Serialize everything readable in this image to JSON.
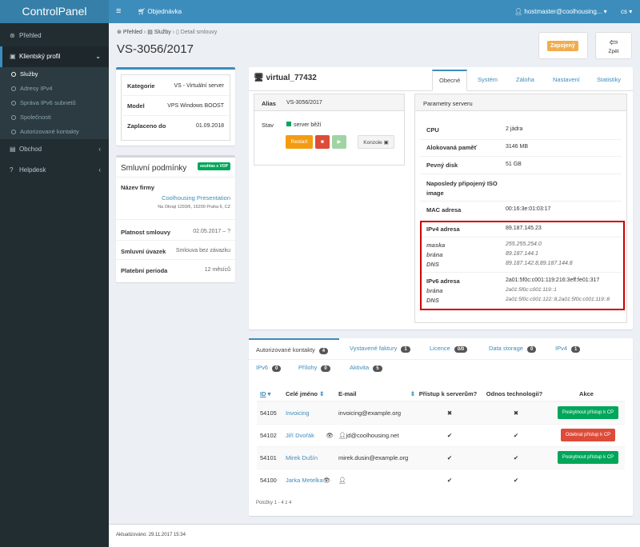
{
  "app": {
    "brand": "ControlPanel"
  },
  "sidebar": {
    "items": [
      {
        "label": "Přehled",
        "icon": "dashboard-icon"
      },
      {
        "label": "Klientský profil",
        "icon": "user-icon"
      },
      {
        "label": "Obchod",
        "icon": "money-icon"
      },
      {
        "label": "Helpdesk",
        "icon": "question-icon"
      }
    ],
    "subitems": [
      "Služby",
      "Adresy IPv4",
      "Správa IPv6 subnetů",
      "Společnosti",
      "Autorizované kontakty"
    ]
  },
  "topbar": {
    "order": "Objednávka",
    "user": "hostmaster@coolhousing...",
    "lang": "cs"
  },
  "breadcrumb": {
    "home": "Přehled",
    "services": "Služby",
    "detail": "Detail smlouvy"
  },
  "page": {
    "title": "VS-3056/2017",
    "status_label": "Zapojený",
    "back_label": "Zpět"
  },
  "contract": {
    "rows": [
      {
        "label": "Kategorie",
        "value": "VS - Virtuální server"
      },
      {
        "label": "Model",
        "value": "VPS Windows BOOST"
      },
      {
        "label": "Zaplaceno do",
        "value": "01.09.2018"
      }
    ]
  },
  "terms": {
    "title": "Smluvní podmínky",
    "badge": "souhlas s VOP",
    "company_label": "Název firmy",
    "company_name": "Coolhousing Presentation",
    "company_address": "Na Okraji 1293/6, 16200 Praha 6, CZ",
    "validity_label": "Platnost smlouvy",
    "validity_value": "02.05.2017 – ?",
    "commitment_label": "Smluvní úvazek",
    "commitment_value": "Smlouva bez závazku",
    "period_label": "Platební perioda",
    "period_value": "12 měsíců"
  },
  "server": {
    "name": "virtual_77432",
    "tabs": [
      "Obecné",
      "Systém",
      "Záloha",
      "Nastavení",
      "Statistiky"
    ],
    "alias_label": "Alias",
    "alias_value": "VS-3056/2017",
    "state_label": "Stav",
    "state_value": "server běží",
    "restart_label": "Restart",
    "console_label": "Konzole"
  },
  "params": {
    "title": "Parametry serveru",
    "rows": [
      {
        "label": "CPU",
        "value": "2 jádra"
      },
      {
        "label": "Alokovaná paměť",
        "value": "3146 MB"
      },
      {
        "label": "Pevný disk",
        "value": "51 GB"
      },
      {
        "label": "Naposledy připojený ISO image",
        "value": ""
      },
      {
        "label": "MAC adresa",
        "value": "00:16:3e:01:03:17"
      }
    ],
    "ipv4_label": "IPv4 adresa",
    "ipv4_value": "89.187.145.23",
    "mask_label": "maska",
    "mask_value": "255.255.254.0",
    "gw_label": "brána",
    "gw_value": "89.187.144.1",
    "dns_label": "DNS",
    "dns_value": "89.187.142.8,89.187.144.8",
    "ipv6_label": "IPv6 adresa",
    "ipv6_value": "2a01:5f0c:c001:119:216:3eff:fe01:317",
    "gw6_label": "brána",
    "gw6_value": "2a01:5f0c:c001:119::1",
    "dns6_label": "DNS",
    "dns6_value": "2a01:5f0c:c001:122::8,2a01:5f0c:c001:119::8"
  },
  "bottom_tabs": [
    {
      "label": "Autorizované kontakty",
      "count": "4"
    },
    {
      "label": "Vystavené faktury",
      "count": "1"
    },
    {
      "label": "Licence",
      "count": "0/0"
    },
    {
      "label": "Data storage",
      "count": "0"
    },
    {
      "label": "IPv4",
      "count": "1"
    },
    {
      "label": "IPv6",
      "count": "0"
    },
    {
      "label": "Přílohy",
      "count": "0"
    },
    {
      "label": "Aktivita",
      "count": "5"
    }
  ],
  "contacts": {
    "headers": [
      "ID",
      "Celé jméno",
      "E-mail",
      "Přístup k serverům?",
      "Odnos technologií?",
      "Akce"
    ],
    "rows": [
      {
        "id": "54105",
        "name": "Invoicing",
        "email": "invoicing@example.org",
        "access": "✖",
        "removal": "✖",
        "action": "Poskytnout přístup k CP",
        "action_type": "grant"
      },
      {
        "id": "54102",
        "name": "Jiří Dvořák",
        "email": "jd@coolhousing.net",
        "access": "✔",
        "removal": "✔",
        "action": "Odebrat přístup k CP",
        "action_type": "revoke"
      },
      {
        "id": "54101",
        "name": "Mirek Dušín",
        "email": "mirek.dusin@example.org",
        "access": "✔",
        "removal": "✔",
        "action": "Poskytnout přístup k CP",
        "action_type": "grant"
      },
      {
        "id": "54100",
        "name": "Jarka Metelka",
        "email": "",
        "access": "✔",
        "removal": "✔",
        "action": "",
        "action_type": "none"
      }
    ],
    "pager": "Položky 1 - 4 z 4"
  },
  "footer": {
    "updated": "Aktualizováno: 29.11.2017 15:34"
  },
  "colors": {
    "primary": "#3c8dbc",
    "success": "#00a65a",
    "danger": "#dd4b39",
    "warning": "#f39c12",
    "sidebar": "#222d32",
    "highlight": "#cc0000"
  }
}
